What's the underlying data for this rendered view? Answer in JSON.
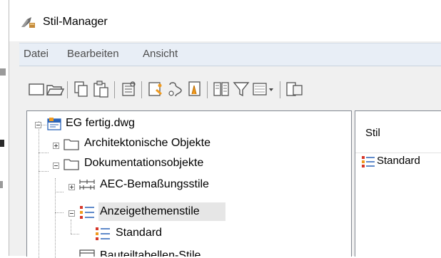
{
  "window": {
    "title": "Stil-Manager"
  },
  "menu": {
    "items": [
      "Datei",
      "Bearbeiten",
      "Ansicht"
    ]
  },
  "toolbar": {
    "buttons": [
      "new-icon",
      "open-icon",
      "copy-icon",
      "paste-icon",
      "purge-icon",
      "edit-style-icon",
      "import-icon",
      "export-icon",
      "compare-icon",
      "filter-icon",
      "view-icon",
      "toggle-view-icon"
    ]
  },
  "tree": {
    "root": "EG fertig.dwg",
    "items": [
      {
        "label": "Architektonische Objekte"
      },
      {
        "label": "Dokumentationsobjekte"
      },
      {
        "label": "AEC-Bemaßungsstile"
      },
      {
        "label": "Anzeigethemenstile"
      },
      {
        "label": "Standard"
      },
      {
        "label": "Bauteiltabellen-Stile"
      }
    ]
  },
  "list": {
    "column_header": "Stil",
    "rows": [
      "Standard"
    ]
  },
  "colors": {
    "menu_bg": "#e8eef6",
    "selection": "#e6e6e6",
    "theme_red": "#d6372a",
    "theme_orange": "#f09a1e",
    "theme_blue": "#2b64b8"
  }
}
